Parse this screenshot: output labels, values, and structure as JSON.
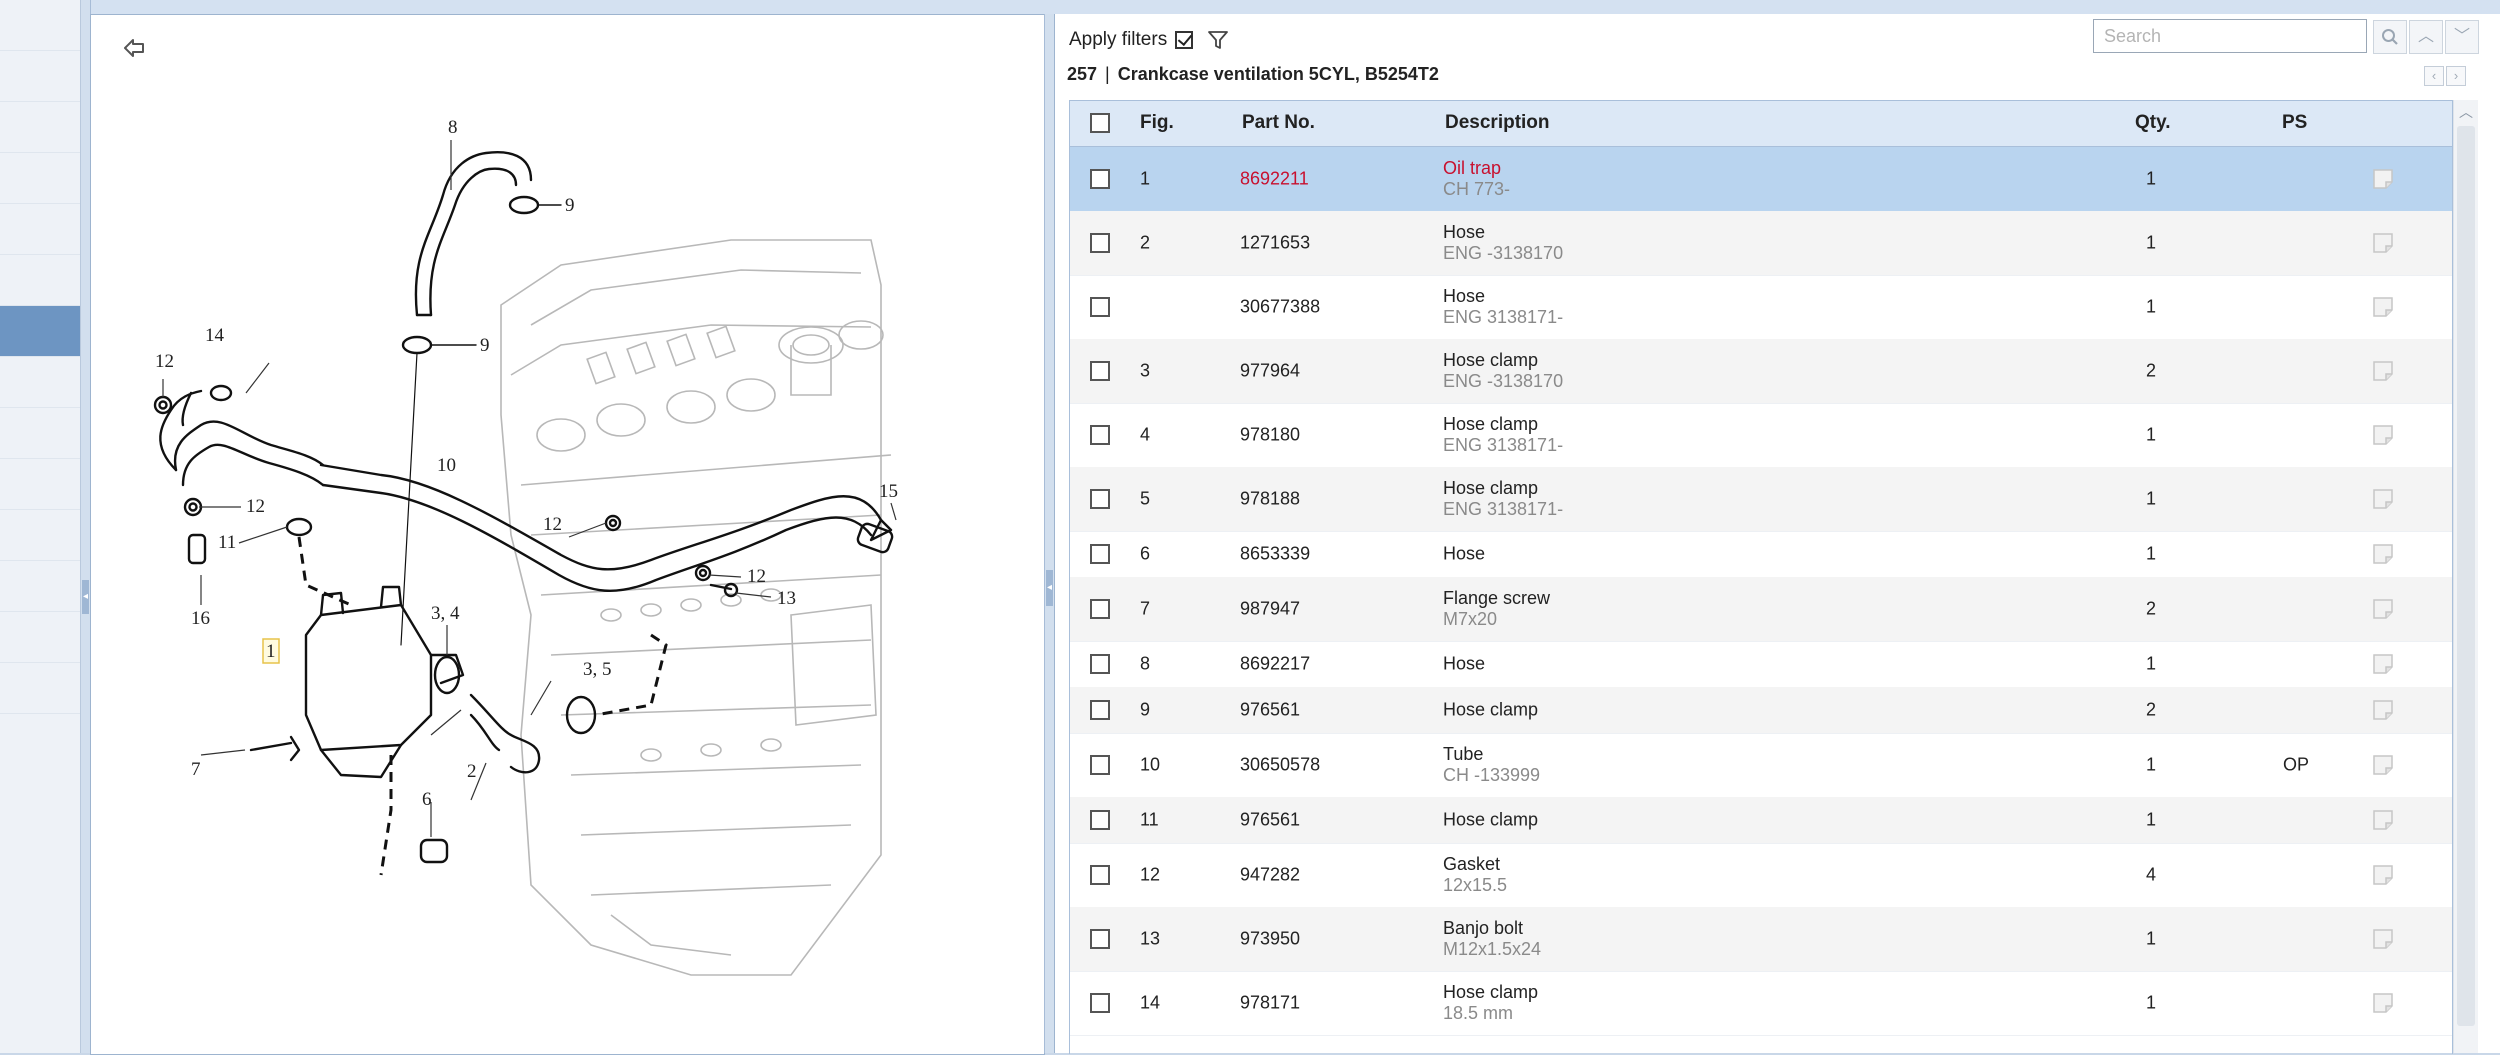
{
  "app": {
    "accent": "#6d95c2",
    "selected_row": "#b9d4ef",
    "selected_text": "#c8102e"
  },
  "toolbar": {
    "apply_filters_label": "Apply filters",
    "apply_filters_checked": true,
    "search_placeholder": "Search",
    "search_value": ""
  },
  "breadcrumb": {
    "group": "257",
    "separator": "|",
    "title": "Crankcase ventilation 5CYL, B5254T2"
  },
  "table": {
    "headers": {
      "fig": "Fig.",
      "part_no": "Part No.",
      "description": "Description",
      "qty": "Qty.",
      "ps": "PS"
    },
    "rows": [
      {
        "fig": "1",
        "part_no": "8692211",
        "desc": "Oil trap",
        "sub": "CH 773-",
        "qty": "1",
        "ps": ""
      },
      {
        "fig": "2",
        "part_no": "1271653",
        "desc": "Hose",
        "sub": "ENG -3138170",
        "qty": "1",
        "ps": ""
      },
      {
        "fig": "",
        "part_no": "30677388",
        "desc": "Hose",
        "sub": "ENG 3138171-",
        "qty": "1",
        "ps": ""
      },
      {
        "fig": "3",
        "part_no": "977964",
        "desc": "Hose clamp",
        "sub": "ENG -3138170",
        "qty": "2",
        "ps": ""
      },
      {
        "fig": "4",
        "part_no": "978180",
        "desc": "Hose clamp",
        "sub": "ENG 3138171-",
        "qty": "1",
        "ps": ""
      },
      {
        "fig": "5",
        "part_no": "978188",
        "desc": "Hose clamp",
        "sub": "ENG 3138171-",
        "qty": "1",
        "ps": ""
      },
      {
        "fig": "6",
        "part_no": "8653339",
        "desc": "Hose",
        "sub": "",
        "qty": "1",
        "ps": ""
      },
      {
        "fig": "7",
        "part_no": "987947",
        "desc": "Flange screw",
        "sub": "M7x20",
        "qty": "2",
        "ps": ""
      },
      {
        "fig": "8",
        "part_no": "8692217",
        "desc": "Hose",
        "sub": "",
        "qty": "1",
        "ps": ""
      },
      {
        "fig": "9",
        "part_no": "976561",
        "desc": "Hose clamp",
        "sub": "",
        "qty": "2",
        "ps": ""
      },
      {
        "fig": "10",
        "part_no": "30650578",
        "desc": "Tube",
        "sub": "CH -133999",
        "qty": "1",
        "ps": "OP"
      },
      {
        "fig": "11",
        "part_no": "976561",
        "desc": "Hose clamp",
        "sub": "",
        "qty": "1",
        "ps": ""
      },
      {
        "fig": "12",
        "part_no": "947282",
        "desc": "Gasket",
        "sub": "12x15.5",
        "qty": "4",
        "ps": ""
      },
      {
        "fig": "13",
        "part_no": "973950",
        "desc": "Banjo bolt",
        "sub": "M12x1.5x24",
        "qty": "1",
        "ps": ""
      },
      {
        "fig": "14",
        "part_no": "978171",
        "desc": "Hose clamp",
        "sub": "18.5 mm",
        "qty": "1",
        "ps": ""
      }
    ]
  },
  "diagram": {
    "callouts": [
      {
        "text": "8"
      },
      {
        "text": "9"
      },
      {
        "text": "9"
      },
      {
        "text": "14"
      },
      {
        "text": "12"
      },
      {
        "text": "10"
      },
      {
        "text": "12"
      },
      {
        "text": "11"
      },
      {
        "text": "16"
      },
      {
        "text": "12"
      },
      {
        "text": "15"
      },
      {
        "text": "12"
      },
      {
        "text": "13"
      },
      {
        "text": "3, 4"
      },
      {
        "text": "3, 5"
      },
      {
        "text": "1"
      },
      {
        "text": "7"
      },
      {
        "text": "2"
      },
      {
        "text": "6"
      }
    ]
  }
}
